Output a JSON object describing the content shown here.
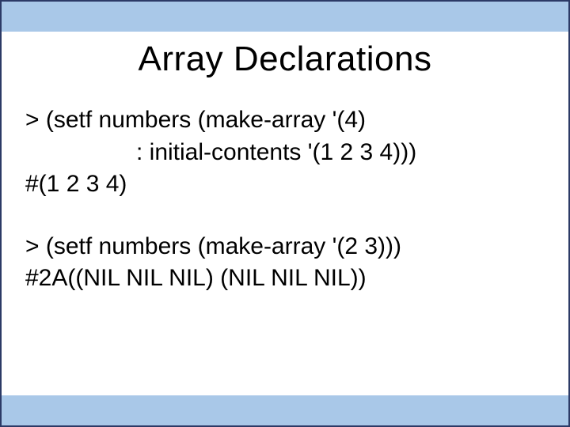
{
  "title": "Array Declarations",
  "block1": {
    "line1": "> (setf numbers (make-array '(4)",
    "line2": ": initial-contents '(1 2 3 4)))",
    "line3": "#(1 2 3 4)"
  },
  "block2": {
    "line1": "> (setf numbers (make-array '(2 3)))",
    "line2": "#2A((NIL NIL NIL) (NIL NIL NIL))"
  }
}
